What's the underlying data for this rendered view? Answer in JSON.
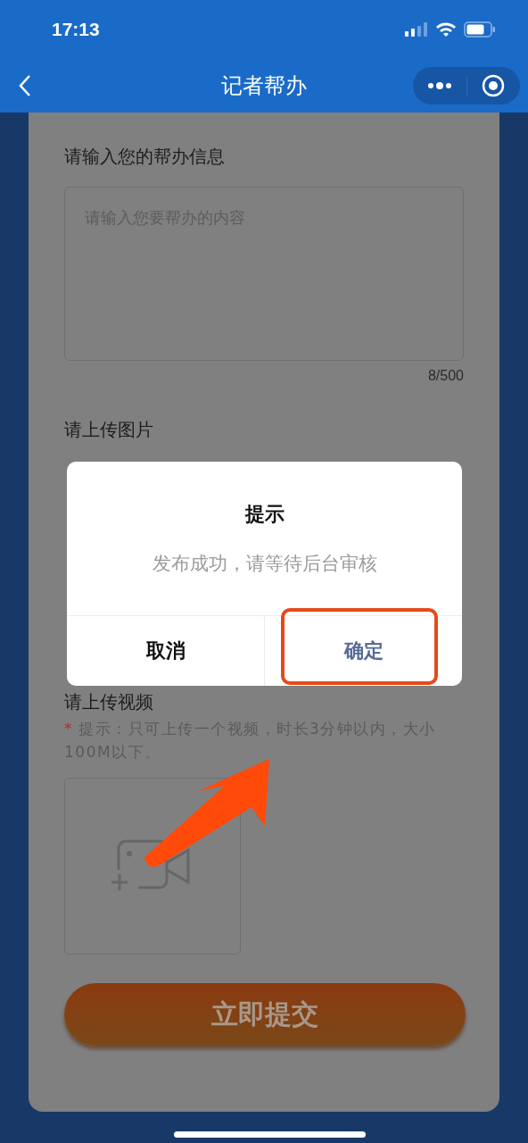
{
  "status_bar": {
    "time": "17:13"
  },
  "nav": {
    "title": "记者帮办"
  },
  "form": {
    "info_label": "请输入您的帮办信息",
    "info_placeholder": "请输入您要帮办的内容",
    "counter": "8/500",
    "image_label": "请上传图片",
    "video_label": "请上传视频",
    "video_hint_mark": "*",
    "video_hint": "提示：只可上传一个视频，时长3分钟以内，大小100M以下。"
  },
  "submit_button": "立即提交",
  "dialog": {
    "title": "提示",
    "message": "发布成功，请等待后台审核",
    "buttons": [
      {
        "label": "取消",
        "kind": "cancel",
        "highlighted": false
      },
      {
        "label": "确定",
        "kind": "confirm",
        "highlighted": true
      }
    ]
  }
}
